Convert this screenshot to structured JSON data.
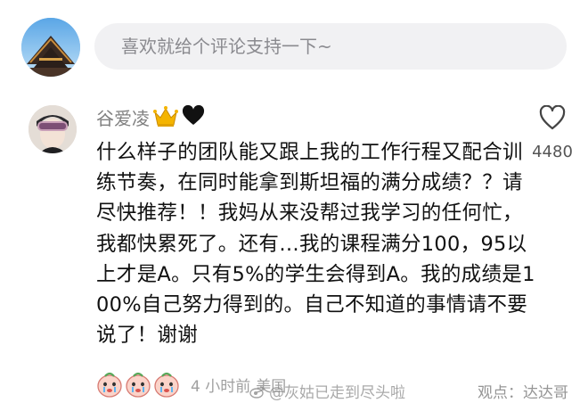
{
  "comment_input": {
    "placeholder": "喜欢就给个评论支持一下~"
  },
  "comment": {
    "username": "谷爱凌",
    "badges": [
      "crown-icon",
      "black-heart-icon"
    ],
    "text": "什么样子的团队能又跟上我的工作行程又配合训练节奏，在同时能拿到斯坦福的满分成绩？？请尽快推荐！！我妈从来没帮过我学习的任何忙，我都快累死了。还有…我的课程满分100，95以上才是A。只有5%的学生会得到A。我的成绩是100%自己努力得到的。自己不知道的事情请不要说了！谢谢",
    "reactions": [
      "crying-face-icon",
      "crying-face-icon",
      "crying-face-icon"
    ],
    "time": "4 小时前",
    "location": "美国",
    "likes": "4480"
  },
  "watermarks": {
    "center": "@灰姑已走到尽头啦",
    "right": "观点：达达哥"
  },
  "colors": {
    "input_bg": "#f1f1f3",
    "meta_gray": "#a0a0a0",
    "text": "#111111"
  }
}
